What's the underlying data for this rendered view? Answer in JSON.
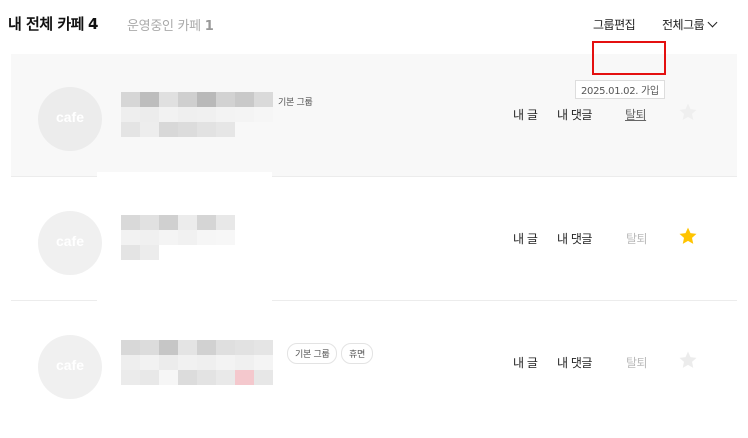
{
  "header": {
    "title": "내 전체 카페",
    "title_count": "4",
    "subtitle": "운영중인 카페",
    "subtitle_count": "1",
    "edit_group": "그룹편집",
    "all_groups": "전체그룹"
  },
  "cafes": [
    {
      "avatar_text": "cafe",
      "tags": [
        "기본 그룹"
      ],
      "my_posts": "내 글",
      "my_comments": "내 댓글",
      "leave": "탈퇴",
      "starred": false,
      "tooltip": "2025.01.02. 가입",
      "highlighted": true
    },
    {
      "avatar_text": "cafe",
      "tags": [],
      "my_posts": "내 글",
      "my_comments": "내 댓글",
      "leave": "탈퇴",
      "starred": true
    },
    {
      "avatar_text": "cafe",
      "tags": [
        "기본 그룹",
        "휴면"
      ],
      "my_posts": "내 글",
      "my_comments": "내 댓글",
      "leave": "탈퇴",
      "starred": false
    }
  ],
  "colors": {
    "highlight_box": "#e41010",
    "star_active": "#ffc400",
    "star_inactive": "#e6e6e6"
  },
  "icons": {
    "star": "star-icon",
    "chevron": "chevron-down-icon"
  }
}
